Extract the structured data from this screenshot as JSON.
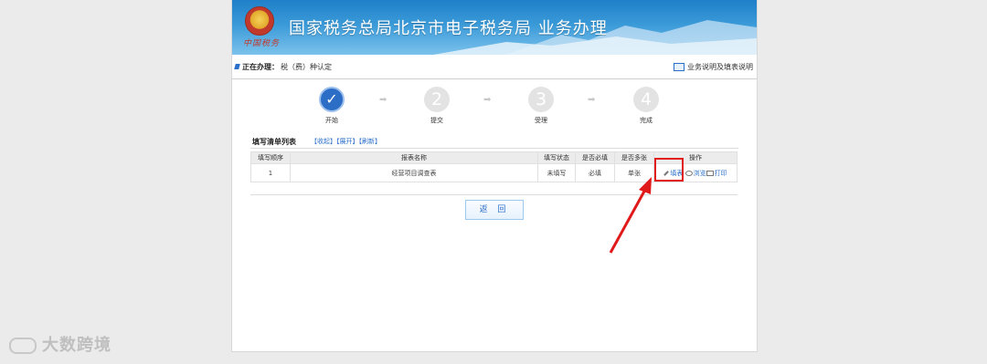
{
  "banner": {
    "title": "国家税务总局北京市电子税务局  业务办理",
    "emblem_text": "中国税务"
  },
  "breadcrumb": {
    "label": "正在办理：",
    "value": "税（费）种认定",
    "help": "业务说明及填表说明"
  },
  "steps": [
    {
      "number": "✓",
      "label": "开始"
    },
    {
      "number": "2",
      "label": "提交"
    },
    {
      "number": "3",
      "label": "受理"
    },
    {
      "number": "4",
      "label": "完成"
    }
  ],
  "list": {
    "title": "填写清单列表",
    "links": [
      "【收起】",
      "【展开】",
      "【刷新】"
    ],
    "columns": [
      "填写顺序",
      "报表名称",
      "填写状态",
      "是否必填",
      "是否多张",
      "操作"
    ],
    "rows": [
      {
        "order": "1",
        "name": "经营项目调查表",
        "status": "未填写",
        "required": "必填",
        "multi": "单张",
        "ops": [
          "填表",
          "浏览",
          "打印"
        ]
      }
    ]
  },
  "back_button": "返 回",
  "watermark": "大数跨境",
  "colors": {
    "accent": "#2a6fc9",
    "highlight": "#e01a1a"
  }
}
